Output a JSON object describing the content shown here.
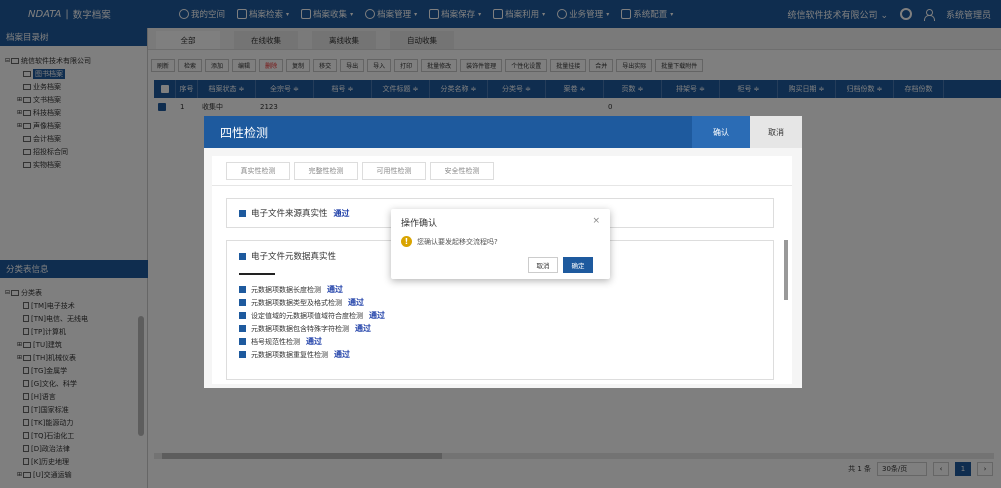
{
  "topbar": {
    "brand": "NDATA",
    "brand_sep": "|",
    "brand_name": "数字档案",
    "nav": [
      {
        "label": "我的空间",
        "icon": "home-icon",
        "dropdown": false
      },
      {
        "label": "档案检索",
        "icon": "search-doc-icon",
        "dropdown": true
      },
      {
        "label": "档案收集",
        "icon": "collect-icon",
        "dropdown": true
      },
      {
        "label": "档案管理",
        "icon": "manage-icon",
        "dropdown": true
      },
      {
        "label": "档案保存",
        "icon": "save-icon",
        "dropdown": true
      },
      {
        "label": "档案利用",
        "icon": "use-icon",
        "dropdown": true
      },
      {
        "label": "业务管理",
        "icon": "business-icon",
        "dropdown": true
      },
      {
        "label": "系统配置",
        "icon": "config-icon",
        "dropdown": true
      }
    ],
    "company": "统信软件技术有限公司",
    "user": "系统管理员"
  },
  "archive_tree": {
    "title": "档案目录树",
    "items": [
      {
        "label": "统信软件技术有限公司",
        "toggle": "⊟",
        "type": "folder",
        "level": 0
      },
      {
        "label": "图书档案",
        "toggle": "",
        "type": "folder",
        "level": 1,
        "selected": true
      },
      {
        "label": "业务档案",
        "toggle": "",
        "type": "folder",
        "level": 1
      },
      {
        "label": "文书档案",
        "toggle": "⊞",
        "type": "folder",
        "level": 1
      },
      {
        "label": "科技档案",
        "toggle": "⊞",
        "type": "folder",
        "level": 1
      },
      {
        "label": "声像档案",
        "toggle": "⊞",
        "type": "folder",
        "level": 1
      },
      {
        "label": "会计档案",
        "toggle": "",
        "type": "folder",
        "level": 1
      },
      {
        "label": "招投标合同",
        "toggle": "",
        "type": "folder",
        "level": 1
      },
      {
        "label": "实物档案",
        "toggle": "",
        "type": "folder",
        "level": 1
      }
    ]
  },
  "class_tree": {
    "title": "分类表信息",
    "items": [
      {
        "label": "分类表",
        "toggle": "⊟",
        "type": "folder",
        "level": 0
      },
      {
        "label": "[TM]电子技术",
        "toggle": "",
        "type": "doc",
        "level": 1
      },
      {
        "label": "[TN]电信、无线电",
        "toggle": "",
        "type": "doc",
        "level": 1
      },
      {
        "label": "[TP]计算机",
        "toggle": "",
        "type": "doc",
        "level": 1
      },
      {
        "label": "[TU]建筑",
        "toggle": "⊞",
        "type": "folder",
        "level": 1
      },
      {
        "label": "[TH]机械仪表",
        "toggle": "⊞",
        "type": "folder",
        "level": 1
      },
      {
        "label": "[TG]金属学",
        "toggle": "",
        "type": "doc",
        "level": 1
      },
      {
        "label": "[G]文化、科学",
        "toggle": "",
        "type": "doc",
        "level": 1
      },
      {
        "label": "[H]语言",
        "toggle": "",
        "type": "doc",
        "level": 1
      },
      {
        "label": "[T]国家标准",
        "toggle": "",
        "type": "doc",
        "level": 1
      },
      {
        "label": "[TK]能源动力",
        "toggle": "",
        "type": "doc",
        "level": 1
      },
      {
        "label": "[TQ]石油化工",
        "toggle": "",
        "type": "doc",
        "level": 1
      },
      {
        "label": "[D]政治法律",
        "toggle": "",
        "type": "doc",
        "level": 1
      },
      {
        "label": "[K]历史地理",
        "toggle": "",
        "type": "doc",
        "level": 1
      },
      {
        "label": "[U]交通运输",
        "toggle": "⊞",
        "type": "folder",
        "level": 1
      }
    ]
  },
  "tabs": [
    "全部",
    "在线收集",
    "离线收集",
    "自动收集"
  ],
  "toolbar": [
    {
      "label": "刷新",
      "red": false
    },
    {
      "label": "检索",
      "red": false
    },
    {
      "label": "添加",
      "red": false
    },
    {
      "label": "编辑",
      "red": false
    },
    {
      "label": "删除",
      "red": true
    },
    {
      "label": "复制",
      "red": false
    },
    {
      "label": "移交",
      "red": false
    },
    {
      "label": "导出",
      "red": false
    },
    {
      "label": "导入",
      "red": false
    },
    {
      "label": "打印",
      "red": false
    },
    {
      "label": "批量修改",
      "red": false
    },
    {
      "label": "装饰件管理",
      "red": false
    },
    {
      "label": "个性化设置",
      "red": false
    },
    {
      "label": "批量挂接",
      "red": false
    },
    {
      "label": "合并",
      "red": false
    },
    {
      "label": "导出实际",
      "red": false
    },
    {
      "label": "批量下载附件",
      "red": false
    }
  ],
  "grid": {
    "columns": [
      {
        "label": "",
        "w": 22
      },
      {
        "label": "序号",
        "w": 22
      },
      {
        "label": "档案状态 ≑",
        "w": 58
      },
      {
        "label": "全宗号 ≑",
        "w": 58
      },
      {
        "label": "档号 ≑",
        "w": 58
      },
      {
        "label": "文件标题 ≑",
        "w": 58
      },
      {
        "label": "分类名称 ≑",
        "w": 58
      },
      {
        "label": "分类号 ≑",
        "w": 58
      },
      {
        "label": "案卷 ≑",
        "w": 58
      },
      {
        "label": "页数 ≑",
        "w": 58
      },
      {
        "label": "排架号 ≑",
        "w": 58
      },
      {
        "label": "柜号 ≑",
        "w": 58
      },
      {
        "label": "购买日期 ≑",
        "w": 58
      },
      {
        "label": "归档份数 ≑",
        "w": 58
      },
      {
        "label": "存档份数",
        "w": 50
      }
    ],
    "rows": [
      {
        "cells": [
          "",
          "1",
          "收集中",
          "2123",
          "",
          "",
          "",
          "",
          "",
          "0",
          "",
          "",
          "",
          "",
          ""
        ]
      }
    ]
  },
  "pager": {
    "total": "共 1 条",
    "per_page": "30条/页",
    "prev": "‹",
    "current": "1",
    "next": "›"
  },
  "four_dialog": {
    "title": "四性检测",
    "ok": "确认",
    "cancel": "取消",
    "subtabs": [
      "真实性检测",
      "完整性检测",
      "可用性检测",
      "安全性检测"
    ],
    "sec1": {
      "label": "电子文件来源真实性",
      "status": "通过"
    },
    "sec2": {
      "label": "电子文件元数据真实性",
      "checks": [
        {
          "label": "元数据项数据长度检测",
          "status": "通过"
        },
        {
          "label": "元数据项数据类型及格式检测",
          "status": "通过"
        },
        {
          "label": "设定值域的元数据项值域符合度检测",
          "status": "通过"
        },
        {
          "label": "元数据项数据包含特殊字符检测",
          "status": "通过"
        },
        {
          "label": "档号规范性检测",
          "status": "通过"
        },
        {
          "label": "元数据项数据重复性检测",
          "status": "通过"
        }
      ]
    }
  },
  "confirm": {
    "title": "操作确认",
    "close": "×",
    "message": "您确认要发起移交流程吗?",
    "cancel": "取消",
    "ok": "确定"
  }
}
